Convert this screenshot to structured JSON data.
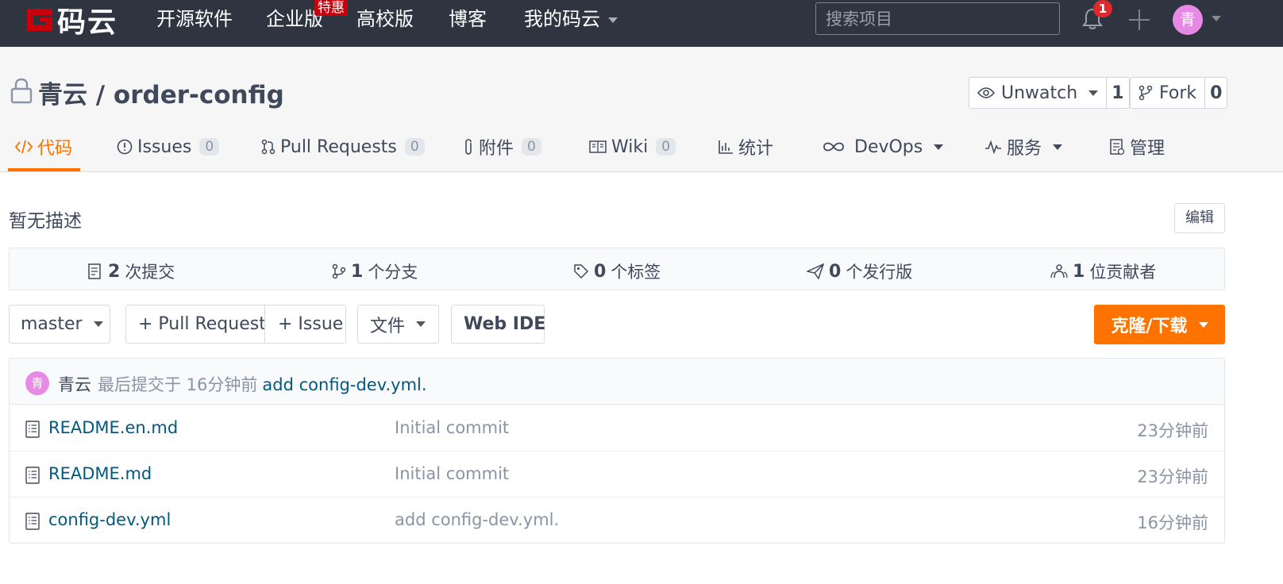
{
  "topnav": {
    "logo_text": "码云",
    "items": [
      {
        "label": "开源软件"
      },
      {
        "label": "企业版"
      },
      {
        "label": "高校版"
      },
      {
        "label": "博客"
      },
      {
        "label": "我的码云"
      }
    ],
    "enterprise_badge": "特惠",
    "search_placeholder": "搜索项目",
    "notification_count": "1",
    "avatar_letter": "青"
  },
  "repo": {
    "owner": "青云",
    "separator": " / ",
    "name": "order-config",
    "unwatch_label": "Unwatch",
    "watch_count": "1",
    "fork_label": "Fork",
    "fork_count": "0"
  },
  "tabs": [
    {
      "label": "代码",
      "icon": "code-icon",
      "active": true
    },
    {
      "label": "Issues",
      "icon": "issue-icon",
      "count": "0"
    },
    {
      "label": "Pull Requests",
      "icon": "pull-request-icon",
      "count": "0"
    },
    {
      "label": "附件",
      "icon": "paperclip-icon",
      "count": "0"
    },
    {
      "label": "Wiki",
      "icon": "book-icon",
      "count": "0"
    },
    {
      "label": "统计",
      "icon": "bar-chart-icon"
    },
    {
      "label": "DevOps",
      "icon": "infinity-icon"
    },
    {
      "label": "服务",
      "icon": "pulse-icon"
    },
    {
      "label": "管理",
      "icon": "settings-doc-icon"
    }
  ],
  "description": {
    "text": "暂无描述",
    "edit_label": "编辑"
  },
  "stats": [
    {
      "count": "2",
      "label": "次提交",
      "icon": "commit-icon"
    },
    {
      "count": "1",
      "label": "个分支",
      "icon": "branch-icon"
    },
    {
      "count": "0",
      "label": "个标签",
      "icon": "tag-icon"
    },
    {
      "count": "0",
      "label": "个发行版",
      "icon": "release-icon"
    },
    {
      "count": "1",
      "label": "位贡献者",
      "icon": "contributors-icon"
    }
  ],
  "toolbar": {
    "branch": "master",
    "pull_request": "+ Pull Request",
    "issue": "+ Issue",
    "file": "文件",
    "web_ide": "Web IDE",
    "clone": "克隆/下载"
  },
  "last_commit": {
    "avatar_letter": "青",
    "author": "青云",
    "meta": "最后提交于 16分钟前",
    "message": "add config-dev.yml."
  },
  "files": [
    {
      "name": "README.en.md",
      "commit": "Initial commit",
      "time": "23分钟前"
    },
    {
      "name": "README.md",
      "commit": "Initial commit",
      "time": "23分钟前"
    },
    {
      "name": "config-dev.yml",
      "commit": "add config-dev.yml.",
      "time": "16分钟前"
    }
  ],
  "colors": {
    "nav_bg": "#2e3440",
    "accent": "#fe7300",
    "link": "#005980",
    "badge_red": "#c7000b",
    "avatar": "#e78ae5"
  }
}
